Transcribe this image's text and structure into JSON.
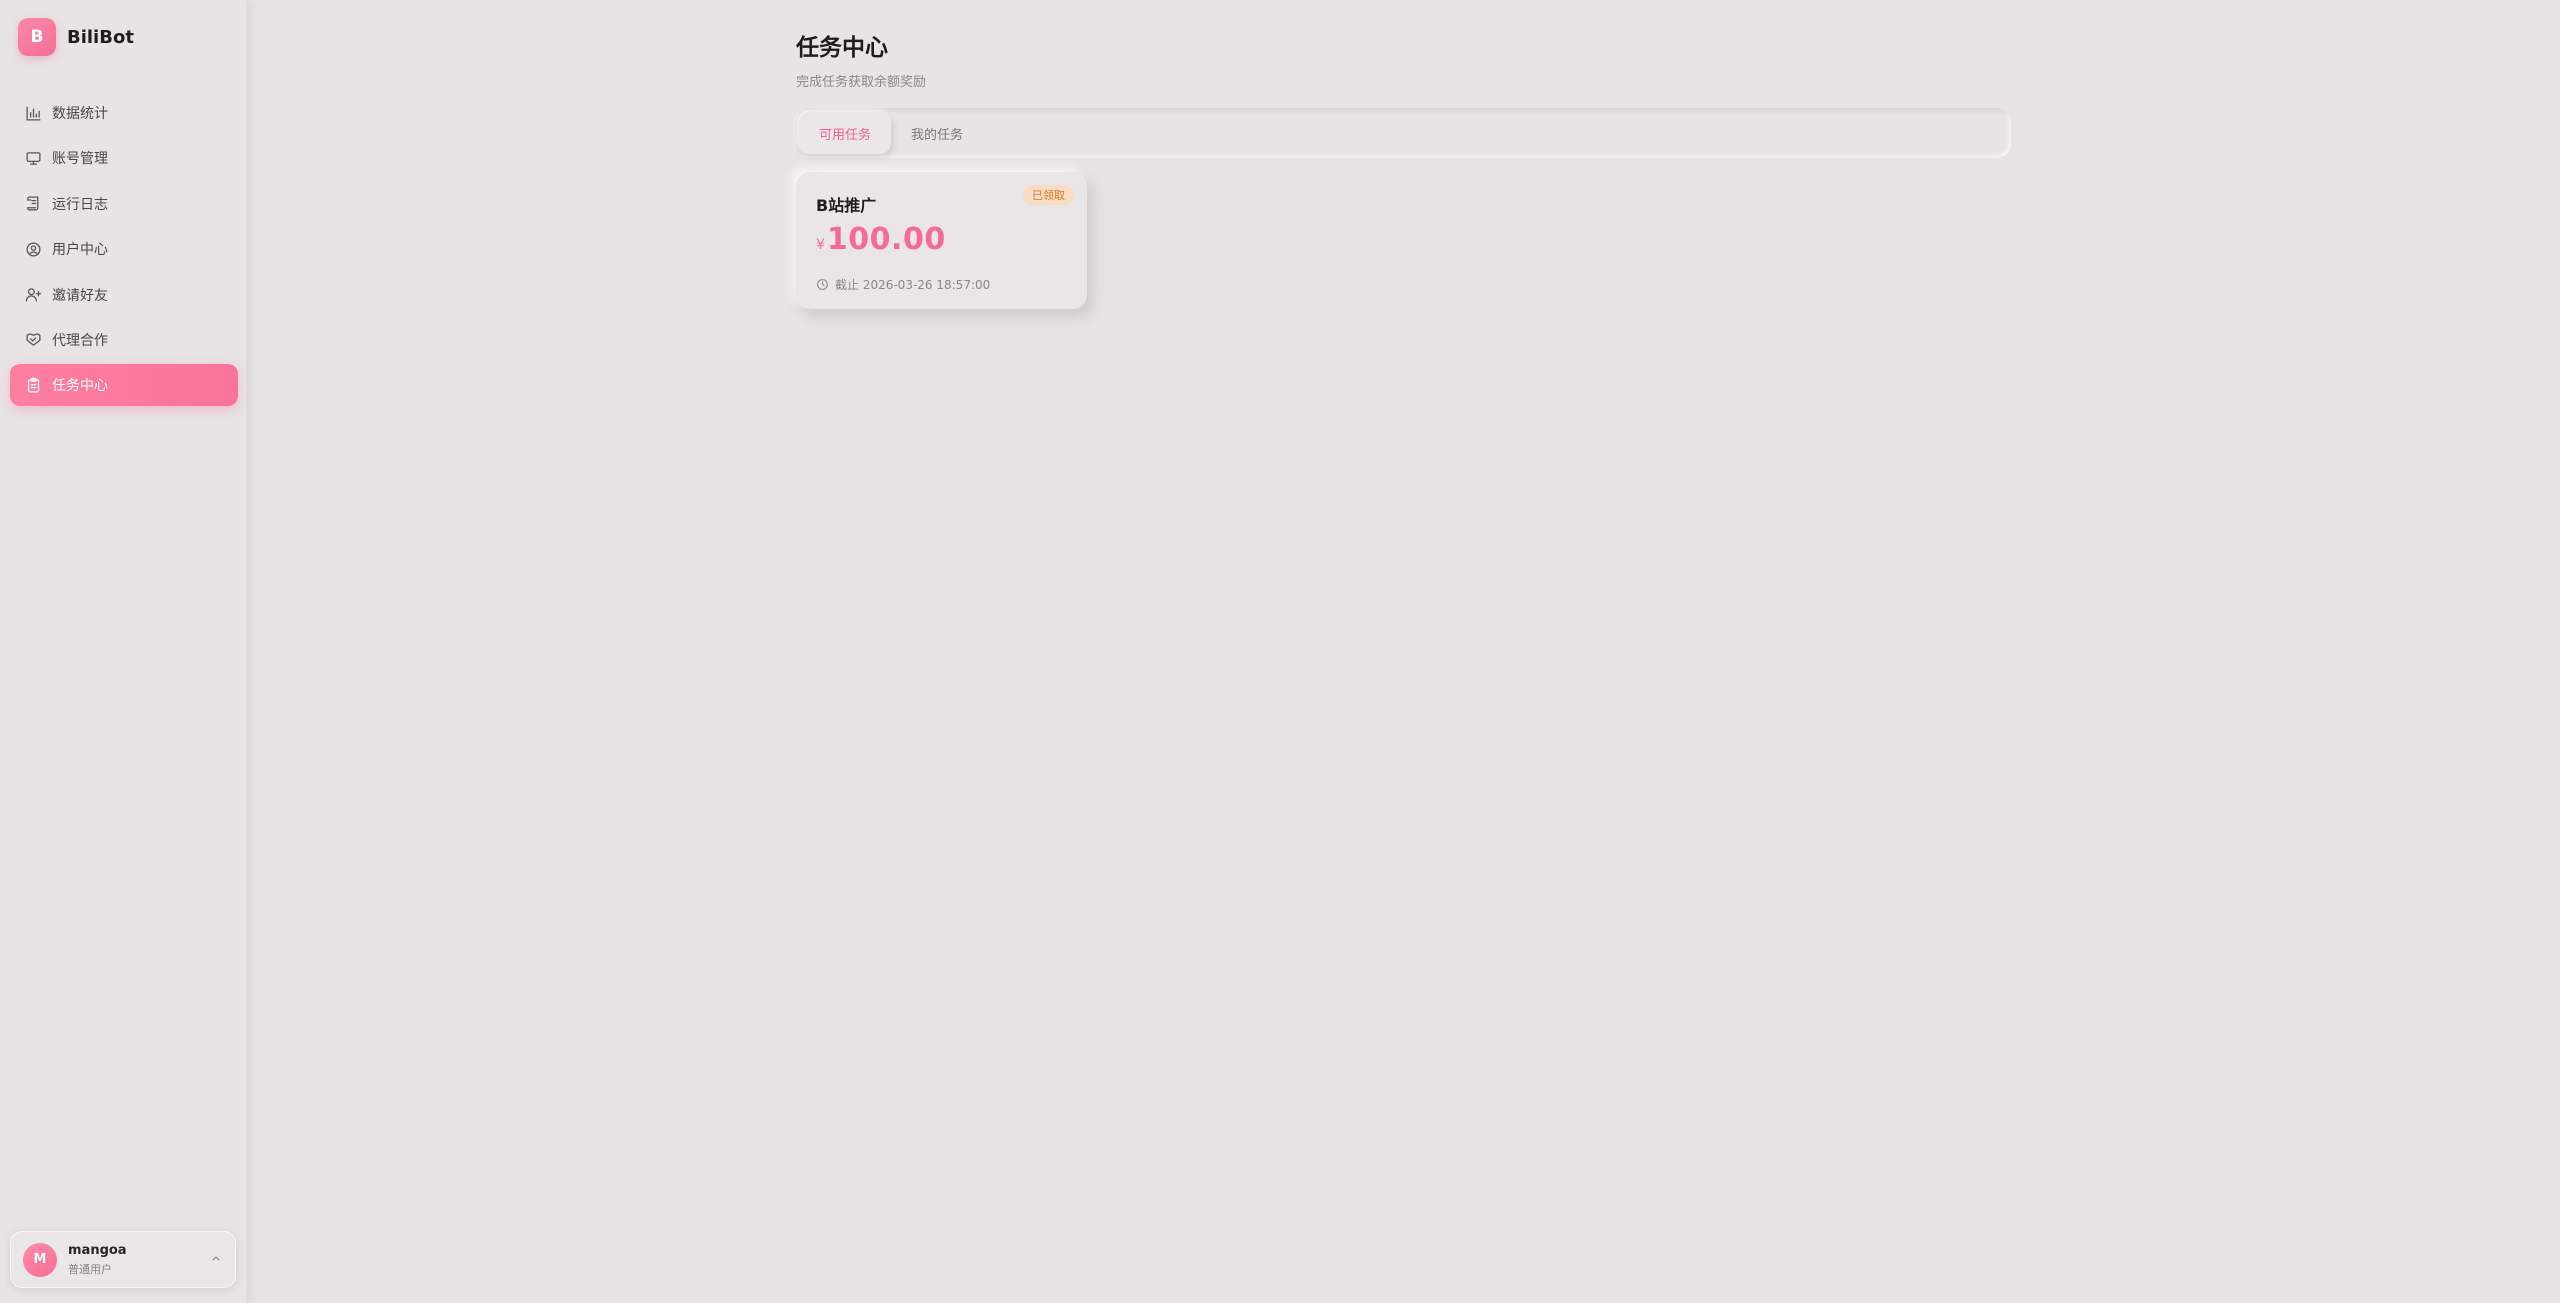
{
  "brand": {
    "logo_letter": "B",
    "name": "BiliBot",
    "accent": "#f9749a"
  },
  "sidebar": {
    "items": [
      {
        "label": "数据统计",
        "icon": "bar-chart-icon",
        "active": false
      },
      {
        "label": "账号管理",
        "icon": "monitor-icon",
        "active": false
      },
      {
        "label": "运行日志",
        "icon": "scroll-icon",
        "active": false
      },
      {
        "label": "用户中心",
        "icon": "user-circle-icon",
        "active": false
      },
      {
        "label": "邀请好友",
        "icon": "user-plus-icon",
        "active": false
      },
      {
        "label": "代理合作",
        "icon": "handshake-icon",
        "active": false
      },
      {
        "label": "任务中心",
        "icon": "clipboard-icon",
        "active": true
      }
    ]
  },
  "user": {
    "avatar_letter": "M",
    "name": "mangoa",
    "role": "普通用户"
  },
  "main": {
    "title": "任务中心",
    "subtitle": "完成任务获取余额奖励",
    "tabs": [
      {
        "label": "可用任务",
        "active": true
      },
      {
        "label": "我的任务",
        "active": false
      }
    ],
    "tasks": [
      {
        "name": "B站推广",
        "badge": "已领取",
        "currency": "¥",
        "reward": "100.00",
        "deadline": "截止 2026-03-26 18:57:00"
      }
    ]
  }
}
